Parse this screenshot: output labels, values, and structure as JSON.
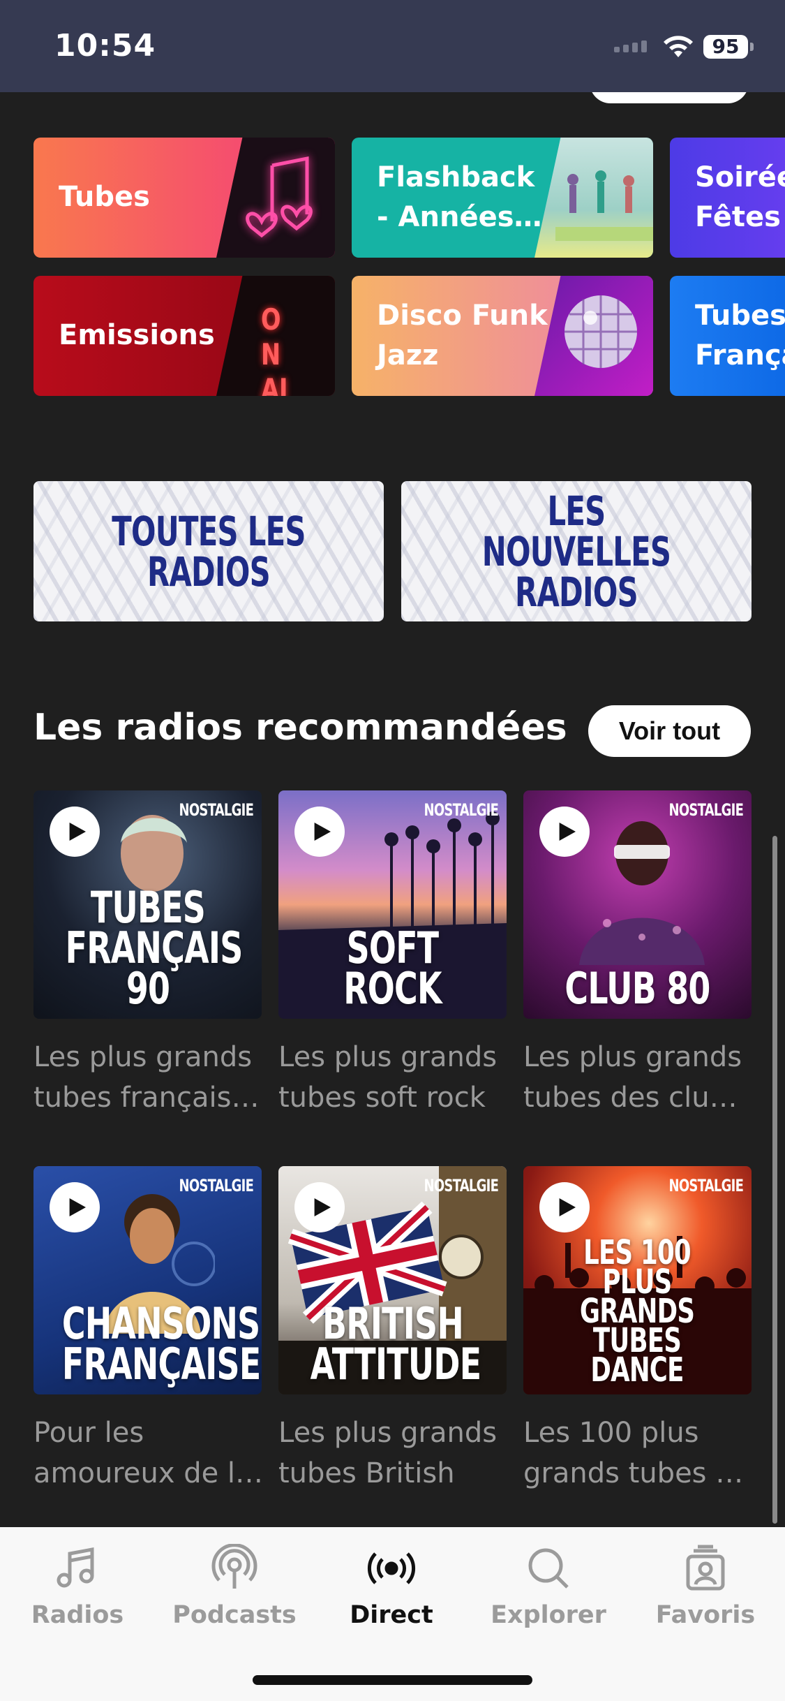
{
  "status_bar": {
    "time": "10:54",
    "battery": "95"
  },
  "genres": [
    {
      "label": "Tubes"
    },
    {
      "label": "Flashback - Années…"
    },
    {
      "label": "Soirée Fêtes"
    },
    {
      "label": "Emissions"
    },
    {
      "label": "Disco Funk Jazz"
    },
    {
      "label": "Tubes Françai"
    }
  ],
  "banners": [
    {
      "label": "TOUTES LES RADIOS"
    },
    {
      "label": "LES NOUVELLES RADIOS"
    }
  ],
  "neon_sign": "ON AIR",
  "recommended": {
    "title": "Les radios recommandées",
    "see_all": "Voir tout",
    "brand": "NOSTALGIE",
    "items": [
      {
        "title": "TUBES FRANÇAIS 90",
        "desc1": "Les plus grands",
        "desc2": "tubes français…"
      },
      {
        "title": "SOFT ROCK",
        "desc1": "Les plus grands",
        "desc2": "tubes soft rock"
      },
      {
        "title": "CLUB 80",
        "desc1": "Les plus grands",
        "desc2": "tubes des club…"
      },
      {
        "title": "CHANSONS FRANÇAISES",
        "desc1": "Pour les",
        "desc2": "amoureux de la…"
      },
      {
        "title": "BRITISH ATTITUDE",
        "desc1": "Les plus grands",
        "desc2": "tubes British"
      },
      {
        "title": "LES 100 PLUS GRANDS TUBES DANCE",
        "desc1": "Les 100 plus",
        "desc2": "grands tubes d…"
      }
    ]
  },
  "tabs": [
    {
      "label": "Radios",
      "icon": "music-note-icon"
    },
    {
      "label": "Podcasts",
      "icon": "podcast-icon"
    },
    {
      "label": "Direct",
      "icon": "broadcast-icon",
      "active": true
    },
    {
      "label": "Explorer",
      "icon": "search-icon"
    },
    {
      "label": "Favoris",
      "icon": "favorites-icon"
    }
  ]
}
